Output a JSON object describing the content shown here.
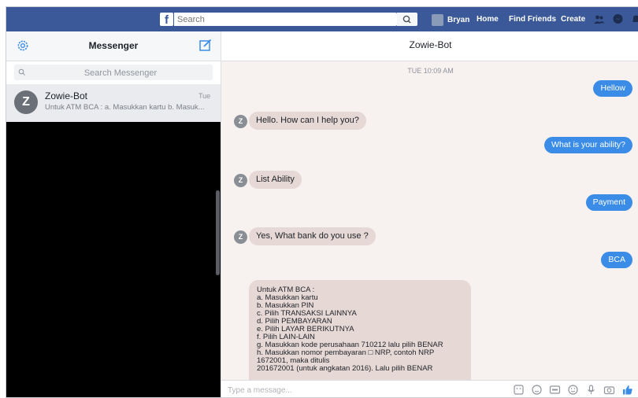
{
  "topbar": {
    "logo": "f",
    "search_placeholder": "Search",
    "user_name": "Bryan",
    "nav": [
      "Home",
      "Find Friends",
      "Create"
    ]
  },
  "sidebar": {
    "title": "Messenger",
    "search_placeholder": "Search Messenger",
    "conversation": {
      "avatar_letter": "Z",
      "name": "Zowie-Bot",
      "time": "Tue",
      "snippet": "Untuk ATM BCA : a. Masukkan kartu b. Masuk..."
    }
  },
  "chat": {
    "title": "Zowie-Bot",
    "timestamp": "TUE 10:09 AM",
    "bot_avatar_letter": "Z",
    "messages": [
      {
        "from": "user",
        "text": "Hellow"
      },
      {
        "from": "bot",
        "text": "Hello. How can I help you?"
      },
      {
        "from": "user",
        "text": "What is your ability?"
      },
      {
        "from": "bot",
        "text": "List Ability"
      },
      {
        "from": "user",
        "text": "Payment"
      },
      {
        "from": "bot",
        "text": "Yes, What bank do you use ?"
      },
      {
        "from": "user",
        "text": "BCA"
      }
    ],
    "long_message_lines": [
      "Untuk ATM BCA :",
      "a. Masukkan kartu",
      "b. Masukkan PIN",
      "c. Pilih TRANSAKSI LAINNYA",
      "d. Pilih PEMBAYARAN",
      "e. Pilih LAYAR BERIKUTNYA",
      "f. Pilih LAIN-LAIN",
      "g. Masukkan kode perusahaan 710212 lalu pilih BENAR",
      "h. Masukkan nomor pembayaran □ NRP, contoh NRP",
      "1672001, maka ditulis",
      "201672001 (untuk angkatan 2016). Lalu pilih BENAR"
    ],
    "composer_placeholder": "Type a message..."
  },
  "colors": {
    "facebook_blue": "#3b5998",
    "outgoing_bubble": "#3b8ce6",
    "incoming_bubble": "#e6d8d4",
    "chat_background": "#f7f1f0"
  },
  "icons": [
    "gear-icon",
    "compose-icon",
    "search-icon",
    "friends-icon",
    "messenger-icon",
    "notifications-icon",
    "sticker-icon",
    "emoji-icon",
    "gif-icon",
    "microphone-icon",
    "camera-icon",
    "like-icon"
  ]
}
